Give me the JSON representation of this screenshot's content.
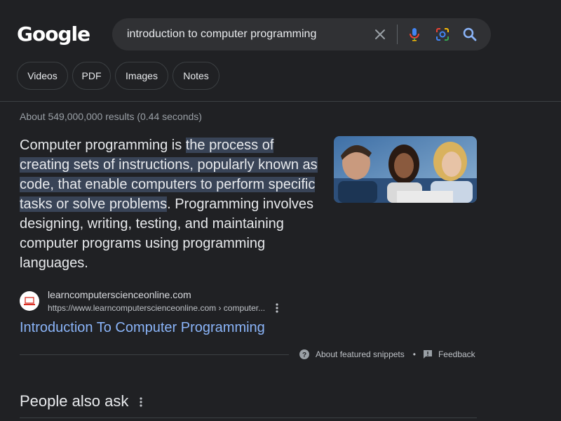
{
  "logo": {
    "text": "Google"
  },
  "search": {
    "query": "introduction to computer programming",
    "clear_icon": "close-icon",
    "voice_icon": "microphone-icon",
    "lens_icon": "camera-lens-icon",
    "search_icon": "search-icon"
  },
  "filters": [
    {
      "label": "Videos"
    },
    {
      "label": "PDF"
    },
    {
      "label": "Images"
    },
    {
      "label": "Notes"
    }
  ],
  "stats": "About 549,000,000 results (0.44 seconds)",
  "featured_snippet": {
    "lead": "Computer programming is ",
    "highlight": "the process of creating sets of instructions, popularly known as code, that enable computers to perform specific tasks or solve problems",
    "rest": ". Programming involves designing, writing, testing, and maintaining computer programs using programming languages.",
    "source": {
      "site_name": "learncomputerscienceonline.com",
      "url": "https://www.learncomputerscienceonline.com › computer...",
      "title": "Introduction To Computer Programming"
    },
    "about_label": "About featured snippets",
    "separator": "•",
    "feedback_label": "Feedback"
  },
  "people_also_ask": {
    "title": "People also ask"
  },
  "colors": {
    "background": "#202124",
    "search_bg": "#303134",
    "link": "#8ab4f8",
    "highlight": "#394457",
    "muted_text": "#9aa0a6"
  }
}
